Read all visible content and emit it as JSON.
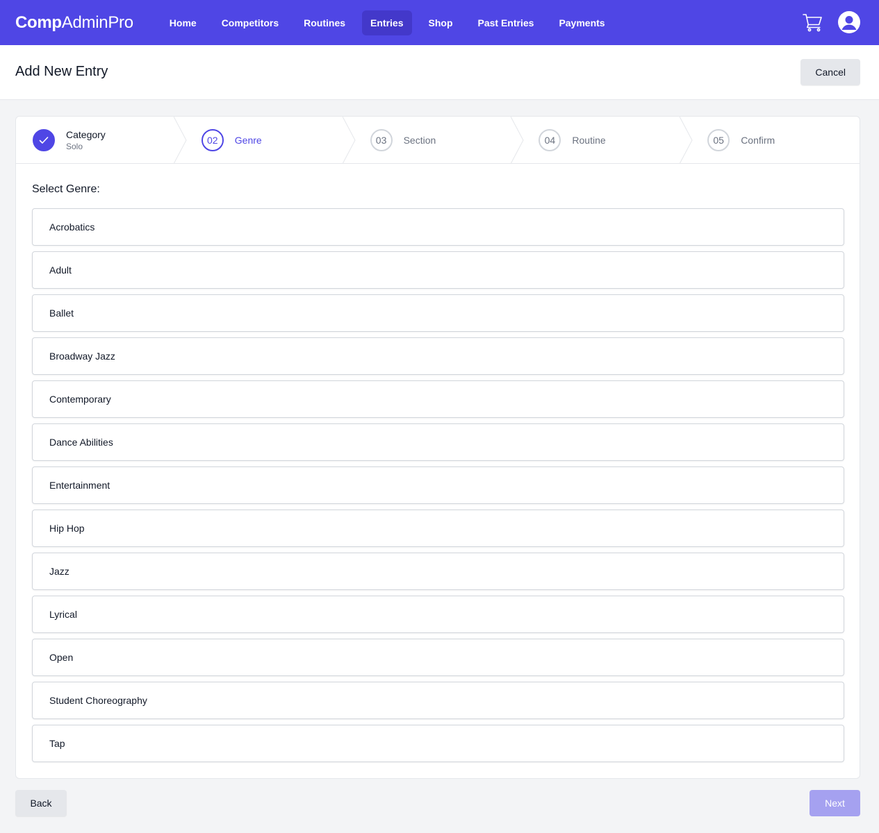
{
  "app": {
    "logo_bold": "Comp",
    "logo_rest": "AdminPro"
  },
  "nav": {
    "items": [
      {
        "label": "Home",
        "active": false
      },
      {
        "label": "Competitors",
        "active": false
      },
      {
        "label": "Routines",
        "active": false
      },
      {
        "label": "Entries",
        "active": true
      },
      {
        "label": "Shop",
        "active": false
      },
      {
        "label": "Past Entries",
        "active": false
      },
      {
        "label": "Payments",
        "active": false
      }
    ],
    "icons": [
      "cart-icon",
      "user-avatar-icon"
    ]
  },
  "header": {
    "title": "Add New Entry",
    "cancel_label": "Cancel"
  },
  "steps": [
    {
      "number": "",
      "name": "Category",
      "sub": "Solo",
      "state": "done"
    },
    {
      "number": "02",
      "name": "Genre",
      "sub": "",
      "state": "current"
    },
    {
      "number": "03",
      "name": "Section",
      "sub": "",
      "state": "upcoming"
    },
    {
      "number": "04",
      "name": "Routine",
      "sub": "",
      "state": "upcoming"
    },
    {
      "number": "05",
      "name": "Confirm",
      "sub": "",
      "state": "upcoming"
    }
  ],
  "genre_select": {
    "label": "Select Genre:",
    "options": [
      "Acrobatics",
      "Adult",
      "Ballet",
      "Broadway Jazz",
      "Contemporary",
      "Dance Abilities",
      "Entertainment",
      "Hip Hop",
      "Jazz",
      "Lyrical",
      "Open",
      "Student Choreography",
      "Tap"
    ]
  },
  "footer": {
    "back_label": "Back",
    "next_label": "Next"
  },
  "colors": {
    "brand": "#4f46e5",
    "brand_active": "#4338ca",
    "next_disabled": "#a5a1f0"
  }
}
